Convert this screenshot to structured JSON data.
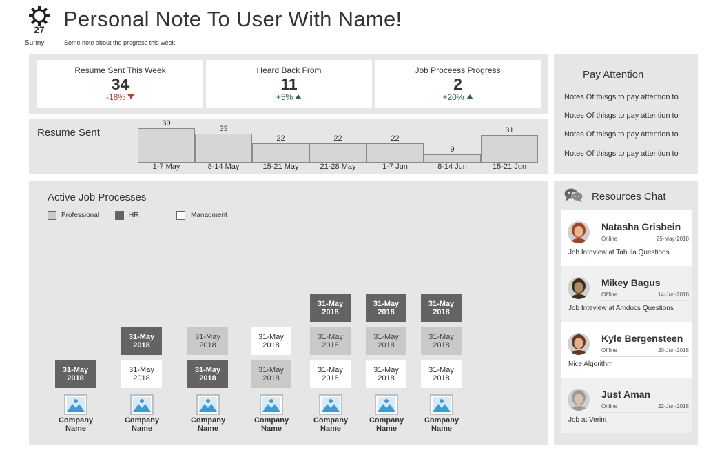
{
  "header": {
    "temperature": "27",
    "condition": "Sunny",
    "title": "Personal Note To User With Name!",
    "subtitle": "Some note about the progress this week"
  },
  "kpis": [
    {
      "label": "Resume Sent This Week",
      "value": "34",
      "delta": "-18%",
      "direction": "down"
    },
    {
      "label": "Heard Back From",
      "value": "11",
      "delta": "+5%",
      "direction": "up"
    },
    {
      "label": "Job Proceess Progress",
      "value": "2",
      "delta": "+20%",
      "direction": "up"
    }
  ],
  "colors": {
    "panel": "#e6e6e6",
    "down": "#c0392b",
    "up": "#2e6b47",
    "hr": "#636363",
    "professional": "#c9c9c9",
    "management": "#ffffff"
  },
  "resume_sent": {
    "title": "Resume Sent",
    "chart_data": {
      "type": "bar",
      "categories": [
        "1-7 May",
        "8-14 May",
        "15-21 May",
        "21-28 May",
        "1-7 Jun",
        "8-14 Jun",
        "15-21 Jun"
      ],
      "values": [
        39,
        33,
        22,
        22,
        22,
        9,
        31
      ],
      "ylim": [
        0,
        39
      ]
    }
  },
  "pay_attention": {
    "title": "Pay Attention",
    "notes": [
      "Notes Of thisgs to pay attention to",
      "Notes Of thisgs to pay attention to",
      "Notes Of thisgs to pay attention to",
      "Notes Of thisgs to pay attention to"
    ]
  },
  "active_jobs": {
    "title": "Active Job Processes",
    "legend": [
      {
        "label": "Professional",
        "type": "pro"
      },
      {
        "label": "HR",
        "type": "hr"
      },
      {
        "label": "Managment",
        "type": "mgmt"
      }
    ],
    "columns": [
      {
        "company": "Company Name",
        "stages": [
          {
            "type": "hr",
            "date": "31-May 2018"
          }
        ]
      },
      {
        "company": "Company Name",
        "stages": [
          {
            "type": "mgmt",
            "date": "31-May 2018"
          },
          {
            "type": "hr",
            "date": "31-May 2018"
          }
        ]
      },
      {
        "company": "Company Name",
        "stages": [
          {
            "type": "hr",
            "date": "31-May 2018"
          },
          {
            "type": "pro",
            "date": "31-May 2018"
          }
        ]
      },
      {
        "company": "Company Name",
        "stages": [
          {
            "type": "pro",
            "date": "31-May 2018"
          },
          {
            "type": "mgmt",
            "date": "31-May 2018"
          }
        ]
      },
      {
        "company": "Company Name",
        "stages": [
          {
            "type": "mgmt",
            "date": "31-May 2018"
          },
          {
            "type": "pro",
            "date": "31-May 2018"
          },
          {
            "type": "hr",
            "date": "31-May 2018"
          }
        ]
      },
      {
        "company": "Company Name",
        "stages": [
          {
            "type": "mgmt",
            "date": "31-May 2018"
          },
          {
            "type": "pro",
            "date": "31-May 2018"
          },
          {
            "type": "hr",
            "date": "31-May 2018"
          }
        ]
      },
      {
        "company": "Company Name",
        "stages": [
          {
            "type": "mgmt",
            "date": "31-May 2018"
          },
          {
            "type": "pro",
            "date": "31-May 2018"
          },
          {
            "type": "hr",
            "date": "31-May 2018"
          }
        ]
      }
    ]
  },
  "chat": {
    "title": "Resources Chat",
    "items": [
      {
        "name": "Natasha Grisbein",
        "status": "Online",
        "date": "25-May-2018",
        "message": "Job Inteview at Tabula Questions",
        "avatar": "avatar-woman-red-hair",
        "hair": "#a0461e",
        "skin": "#e7b591"
      },
      {
        "name": "Mikey Bagus",
        "status": "Offline",
        "date": "14-Jun-2018",
        "message": "Job Inteview at Amdocs Questions",
        "avatar": "avatar-man-bearded",
        "hair": "#3b3020",
        "skin": "#b58a62"
      },
      {
        "name": "Kyle Bergensteen",
        "status": "Offline",
        "date": "20-Jun-2018",
        "message": "Nice Algorithm",
        "avatar": "avatar-woman-brown-hair",
        "hair": "#6a3820",
        "skin": "#e3b08c"
      },
      {
        "name": "Just Aman",
        "status": "Online",
        "date": "22-Jun-2018",
        "message": "Job at Verint",
        "avatar": "avatar-man-gray-hair",
        "hair": "#9a9a9a",
        "skin": "#e0c0a4"
      }
    ]
  }
}
